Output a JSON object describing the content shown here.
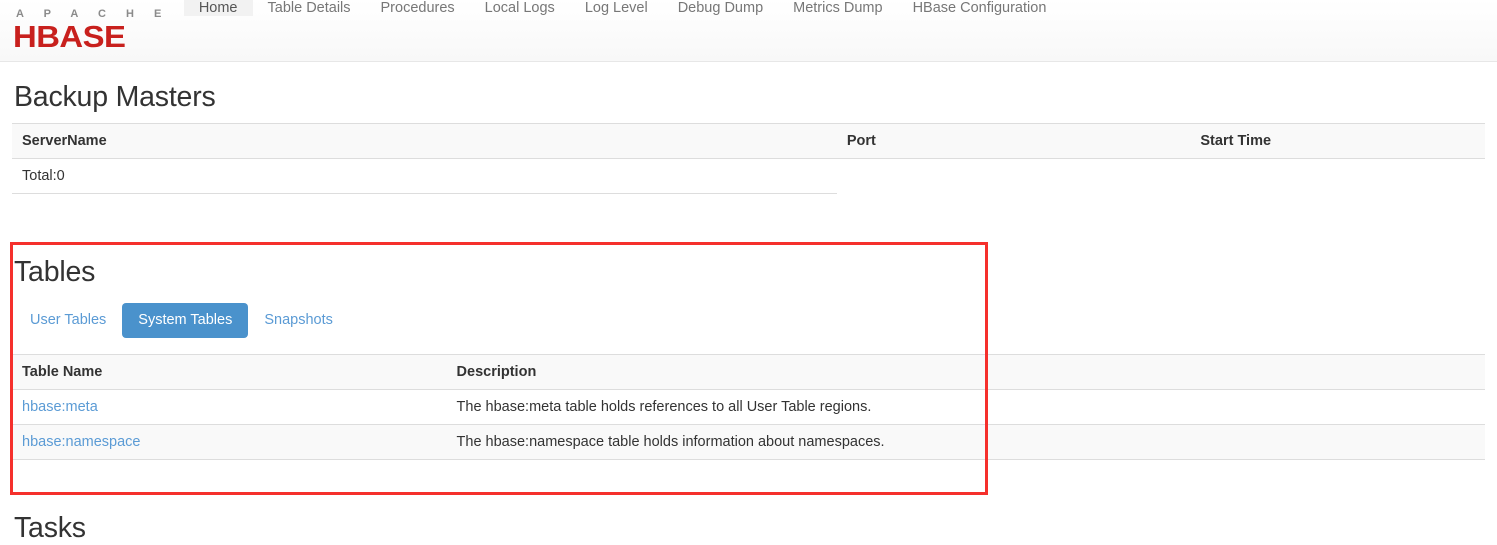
{
  "navbar": {
    "brand": {
      "apache_text": "A P A C H E",
      "hbase_text": "HBASE",
      "apache_color": "#8b8b8b",
      "hbase_color": "#c8201d"
    },
    "items": [
      {
        "label": "Home",
        "active": true
      },
      {
        "label": "Table Details",
        "active": false
      },
      {
        "label": "Procedures",
        "active": false
      },
      {
        "label": "Local Logs",
        "active": false
      },
      {
        "label": "Log Level",
        "active": false
      },
      {
        "label": "Debug Dump",
        "active": false
      },
      {
        "label": "Metrics Dump",
        "active": false
      },
      {
        "label": "HBase Configuration",
        "active": false
      }
    ]
  },
  "backup_masters": {
    "title": "Backup Masters",
    "columns": [
      "ServerName",
      "Port",
      "Start Time"
    ],
    "total_label": "Total:0"
  },
  "tables_section": {
    "title": "Tables",
    "highlight_color": "#f5302c",
    "tabs": [
      {
        "label": "User Tables",
        "active": false
      },
      {
        "label": "System Tables",
        "active": true
      },
      {
        "label": "Snapshots",
        "active": false
      }
    ],
    "columns": [
      "Table Name",
      "Description"
    ],
    "rows": [
      {
        "name": "hbase:meta",
        "description": "The hbase:meta table holds references to all User Table regions."
      },
      {
        "name": "hbase:namespace",
        "description": "The hbase:namespace table holds information about namespaces."
      }
    ]
  },
  "tasks_section": {
    "title": "Tasks"
  },
  "theme": {
    "link_color": "#5b9bd5",
    "active_tab_bg": "#4a92cc",
    "table_border": "#dddddd",
    "stripe_bg": "#f9f9f9"
  }
}
